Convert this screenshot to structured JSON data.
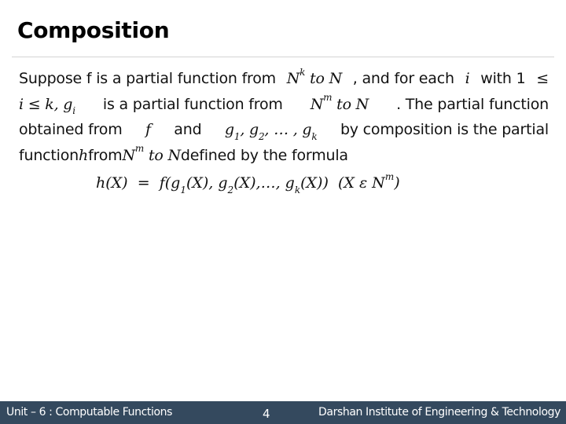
{
  "slide": {
    "title": "Composition",
    "body_lines": [
      {
        "parts": [
          "Suppose f is a partial function from ",
          "N",
          "k",
          " to N",
          ", and for each ",
          "i",
          " with 1 ",
          "≤"
        ]
      },
      {
        "parts": [
          "i",
          " ≤ ",
          "k, g",
          "i",
          " is a partial function from ",
          "N",
          "m",
          " to N",
          ". The partial function"
        ]
      },
      {
        "parts": [
          "obtained from ",
          "f",
          " and ",
          "g",
          "1",
          ", g",
          "2",
          ", … , g",
          "k",
          " by composition is the partial"
        ]
      },
      {
        "parts": [
          "function ",
          "h",
          " from ",
          "N",
          "m",
          " to N",
          " defined by the formula"
        ]
      }
    ],
    "formula": {
      "lhs": "h(X)",
      "eq": "=",
      "rhs_a": "f(g",
      "sub1": "1",
      "rhs_b": "(X), g",
      "sub2": "2",
      "rhs_c": "(X),…, g",
      "subk": "k",
      "rhs_d": "(X))",
      "domain_a": "(X ε N",
      "domain_sup": "m",
      "domain_b": ")"
    }
  },
  "footer": {
    "unit": "Unit – 6 : Computable Functions",
    "page_number": "4",
    "institute": "Darshan Institute of Engineering & Technology",
    "background_color": "#34495e"
  }
}
